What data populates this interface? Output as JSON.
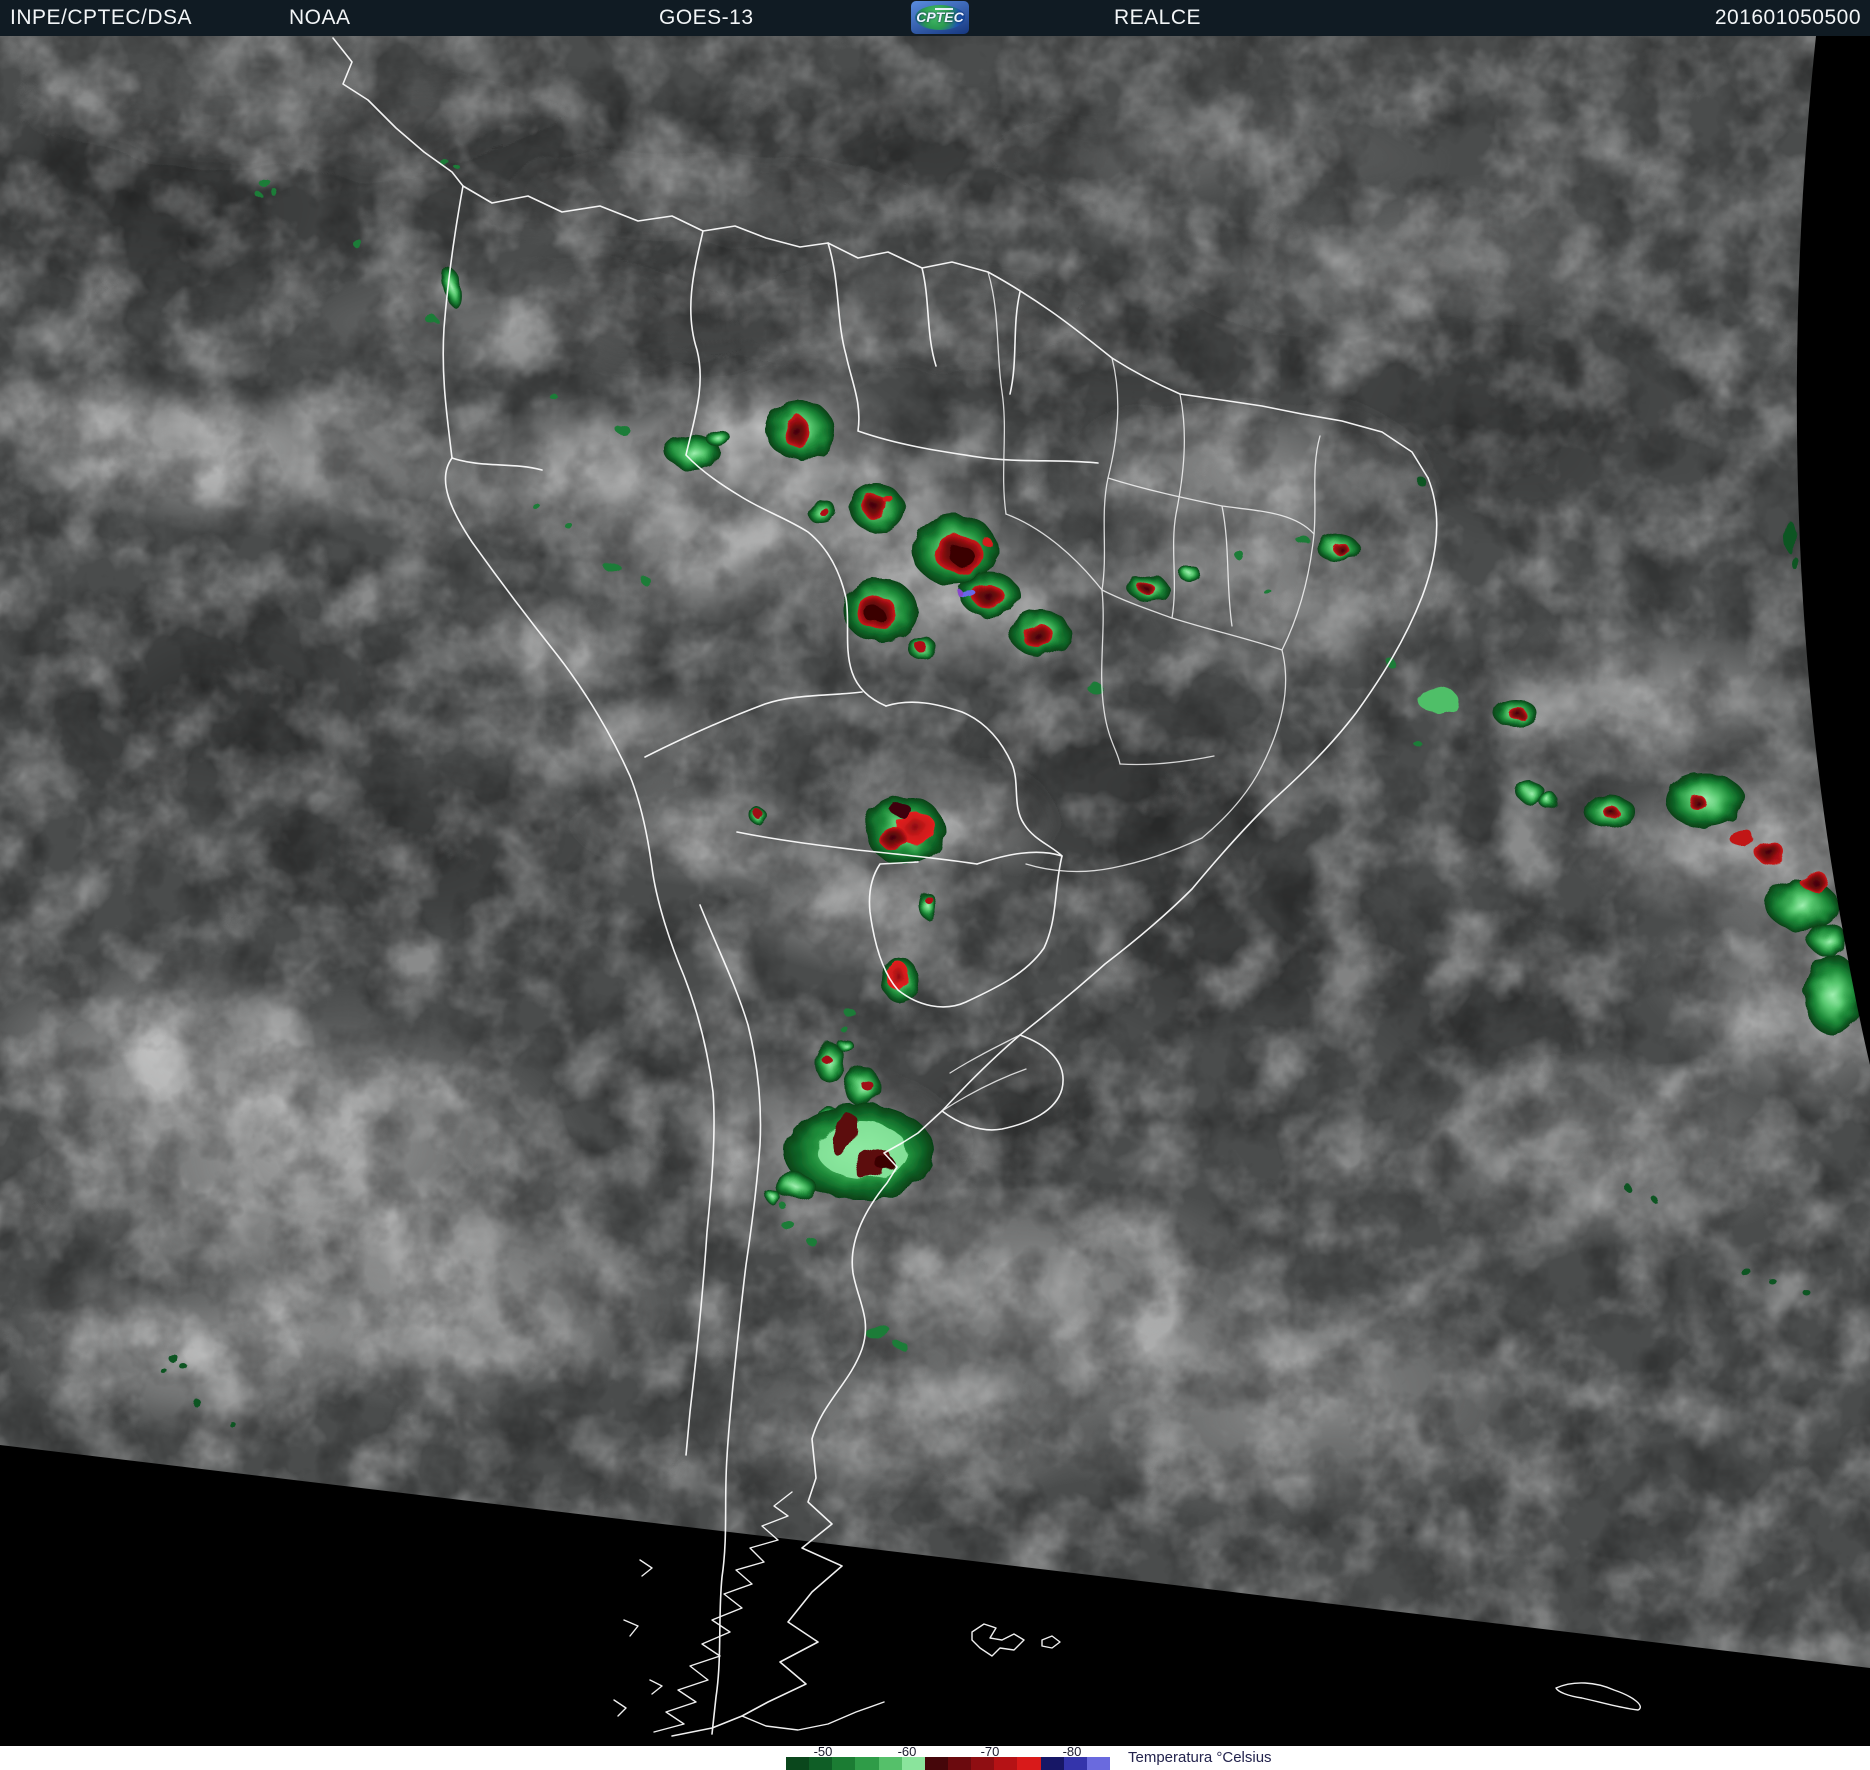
{
  "header": {
    "agency": "INPE/CPTEC/DSA",
    "operator": "NOAA",
    "satellite": "GOES-13",
    "logo_text": "CPTEC",
    "product": "REALCE",
    "timestamp": "201601050500",
    "bar_color": "#101b23",
    "text_color": "#f2f5f7"
  },
  "scale": {
    "title": "Temperatura °Celsius",
    "ticks": [
      "-50",
      "-60",
      "-70",
      "-80"
    ],
    "segments": [
      "#0a471c",
      "#0f5e26",
      "#1b7c33",
      "#2f9c48",
      "#55c06a",
      "#8ae49c",
      "#45060a",
      "#6b0a0e",
      "#8f0e12",
      "#b51215",
      "#d91a1a",
      "#171766",
      "#3434ab",
      "#6a6ade"
    ],
    "background": "#ffffff",
    "label_color": "#1c1c2e"
  },
  "map": {
    "border_color": "#ffffff",
    "space_color": "#000000",
    "enhancement_palette": {
      "cold_green": "#2f9c48",
      "very_cold_red": "#b51215",
      "extreme_cold_blue": "#3434ab"
    }
  }
}
